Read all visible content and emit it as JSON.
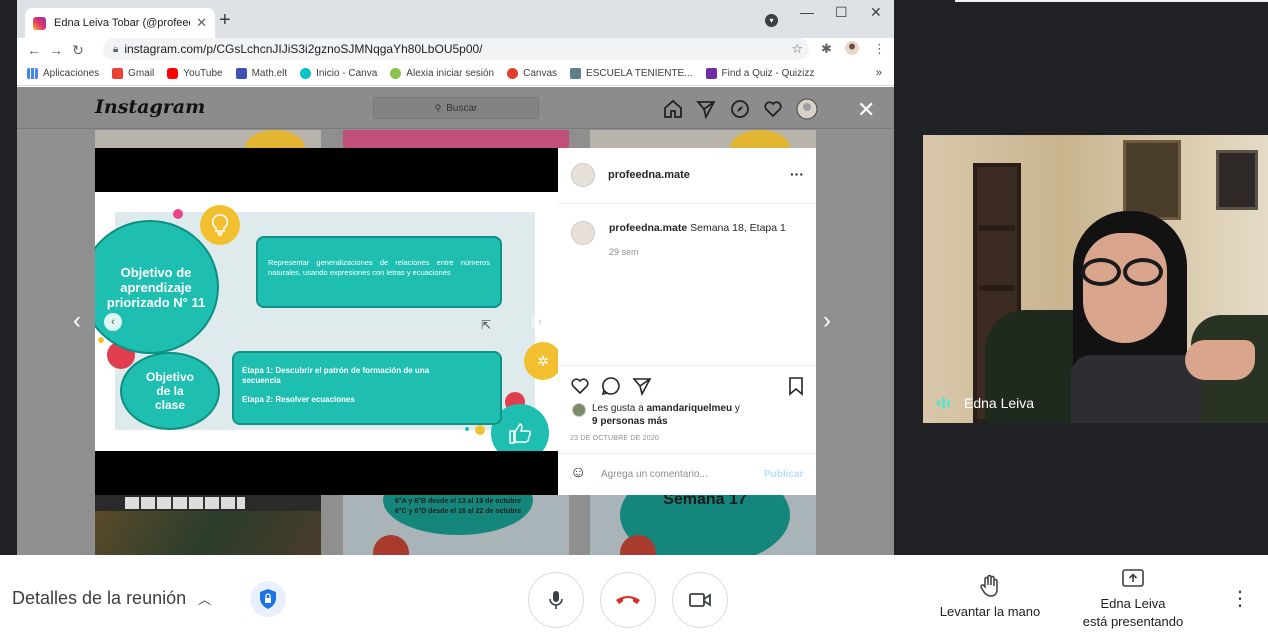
{
  "browser": {
    "tab_title": "Edna Leiva Tobar (@profeedna.m",
    "url": "instagram.com/p/CGsLchcnJIJiS3i2gznoSJMNqgaYh80LbOU5p00/",
    "bookmarks": [
      {
        "label": "Aplicaciones",
        "color": "#4285f4"
      },
      {
        "label": "Gmail",
        "color": "#ea4335"
      },
      {
        "label": "YouTube",
        "color": "#ff0000"
      },
      {
        "label": "Math.elt",
        "color": "#3f51b5"
      },
      {
        "label": "Inicio - Canva",
        "color": "#00c4cc"
      },
      {
        "label": "Alexia iniciar sesión",
        "color": "#8bc34a"
      },
      {
        "label": "Canvas",
        "color": "#e13f2b"
      },
      {
        "label": "ESCUELA TENIENTE...",
        "color": "#607d8b"
      },
      {
        "label": "Find a Quiz - Quizizz",
        "color": "#6f2da8"
      }
    ],
    "bookmarks_more": "»"
  },
  "instagram": {
    "logo": "Instagram",
    "search_placeholder": "Buscar",
    "slide": {
      "circle_objective": "Objetivo de aprendizaje priorizado N° 11",
      "box_objective": "Representar generalizaciones de relaciones entre números naturales, usando expresiones con letras y ecuaciones",
      "circle_class": "Objetivo de la clase",
      "stage_1": "Etapa 1: Descubrir el patrón de formación de una secuencia",
      "stage_2": "Etapa 2: Resolver ecuaciones"
    },
    "thumb_text_1": "6°A y 6°B desde el 13 al 19 de octubre",
    "thumb_text_2": "6°C y 6°D desde el 16 al 22 de octubre",
    "thumb_text_3": "Semana 17",
    "post": {
      "username": "profeedna.mate",
      "more": "···",
      "caption_user": "profeedna.mate",
      "caption": "Semana 18, Etapa 1",
      "age": "29 sem",
      "likes_prefix": "Les gusta a",
      "likes_user": "amandariquelmeu",
      "likes_y": "y",
      "likes_others": "9 personas más",
      "date": "23 DE OCTUBRE DE 2020",
      "comment_placeholder": "Agrega un comentario...",
      "publish": "Publicar"
    }
  },
  "participant": {
    "name": "Edna Leiva"
  },
  "meet": {
    "meeting_details": "Detalles de la reunión",
    "raise_hand": "Levantar la mano",
    "presenter_line1": "Edna Leiva",
    "presenter_line2": "está presentando"
  },
  "colors": {
    "hangup": "#d93025",
    "teal": "#1ebfb0",
    "link_blue": "#b2dffc"
  }
}
